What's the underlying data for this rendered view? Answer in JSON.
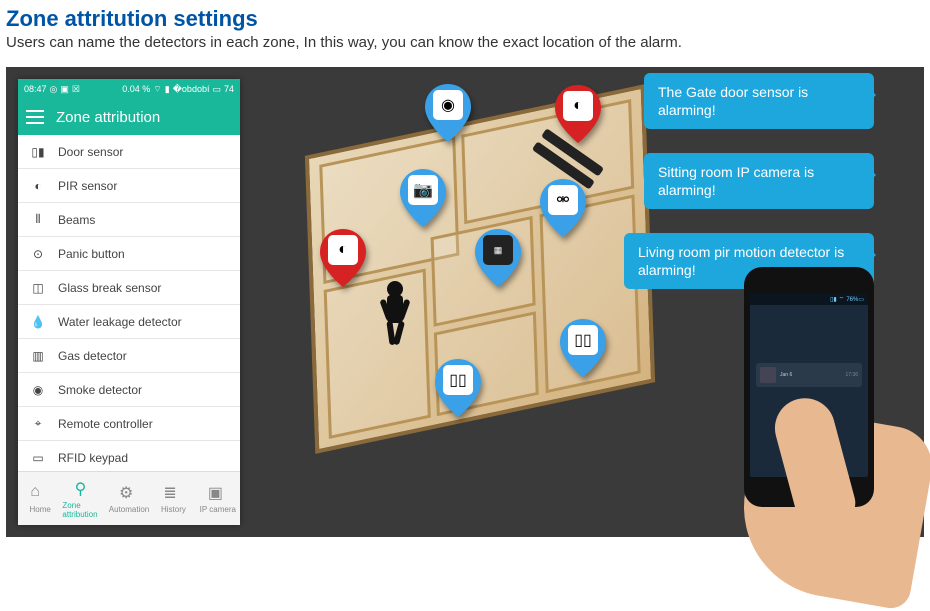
{
  "header": {
    "title": "Zone attritution settings",
    "subtitle": "Users can name the detectors in each zone, In this way, you can know the exact location of the alarm."
  },
  "app": {
    "status": {
      "time": "08:47",
      "stat_text": "0.04 %",
      "battery": "74"
    },
    "title": "Zone attribution",
    "zones": [
      {
        "label": "Door sensor",
        "icon": "door-sensor-icon"
      },
      {
        "label": "PIR sensor",
        "icon": "pir-sensor-icon"
      },
      {
        "label": "Beams",
        "icon": "beams-icon"
      },
      {
        "label": "Panic button",
        "icon": "panic-button-icon"
      },
      {
        "label": "Glass break sensor",
        "icon": "glass-break-icon"
      },
      {
        "label": "Water leakage detector",
        "icon": "water-leak-icon"
      },
      {
        "label": "Gas detector",
        "icon": "gas-detector-icon"
      },
      {
        "label": "Smoke detector",
        "icon": "smoke-detector-icon"
      },
      {
        "label": "Remote controller",
        "icon": "remote-controller-icon"
      },
      {
        "label": "RFID keypad",
        "icon": "rfid-keypad-icon"
      }
    ],
    "nav": [
      {
        "label": "Home",
        "active": false
      },
      {
        "label": "Zone attribution",
        "active": true
      },
      {
        "label": "Automation",
        "active": false
      },
      {
        "label": "History",
        "active": false
      },
      {
        "label": "IP camera",
        "active": false
      }
    ]
  },
  "alerts": {
    "b1": "The Gate door sensor is alarming!",
    "b2": "Sitting room IP camera is alarming!",
    "b3": "Living room pir motion detector is alarming!"
  },
  "notification": {
    "sender": "Jan 6",
    "time": "17:36"
  }
}
